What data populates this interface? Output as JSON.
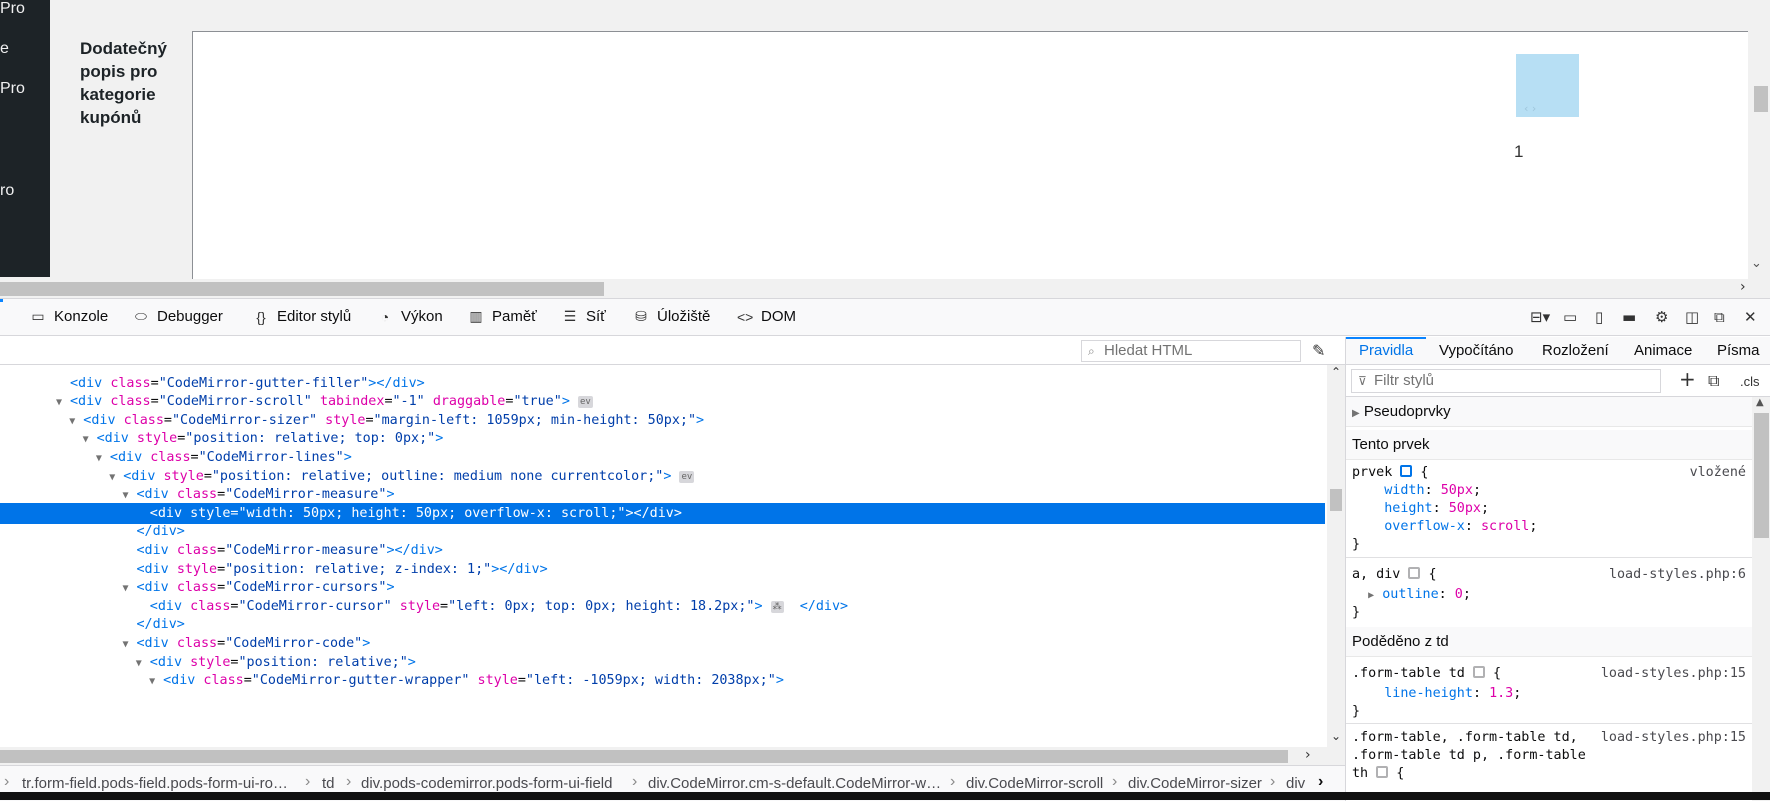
{
  "page": {
    "sidebar_items": [
      "Pro",
      "e",
      "Pro",
      "ro"
    ],
    "field_label": "Dodatečný popis pro kategorie kupónů",
    "editor_line_number": "1",
    "measure_arrows": "‹ ›"
  },
  "toolbar": {
    "tabs": [
      {
        "label": "Konzole",
        "icon": "console-icon"
      },
      {
        "label": "Debugger",
        "icon": "debugger-icon"
      },
      {
        "label": "Editor stylů",
        "icon": "style-editor-icon"
      },
      {
        "label": "Výkon",
        "icon": "performance-icon"
      },
      {
        "label": "Paměť",
        "icon": "memory-icon"
      },
      {
        "label": "Síť",
        "icon": "network-icon"
      },
      {
        "label": "Úložiště",
        "icon": "storage-icon"
      },
      {
        "label": "DOM",
        "icon": "dom-icon"
      }
    ]
  },
  "inspector": {
    "search_placeholder": "Hledat HTML",
    "markup_lines": [
      {
        "cut": true
      },
      {
        "indent": 1,
        "tw": "",
        "html": "<span class='tg'>&lt;div</span> <span class='an'>class</span>=<span class='av'>\"CodeMirror-gutter-filler\"</span><span class='tg'>&gt;&lt;/div&gt;</span>"
      },
      {
        "indent": 1,
        "tw": "▼",
        "html": "<span class='tg'>&lt;div</span> <span class='an'>class</span>=<span class='av'>\"CodeMirror-scroll\"</span> <span class='an'>tabindex</span>=<span class='av'>\"-1\"</span> <span class='an'>draggable</span>=<span class='av'>\"true\"</span><span class='tg'>&gt;</span> <span class='ev'>ev</span>"
      },
      {
        "indent": 2,
        "tw": "▼",
        "html": "<span class='tg'>&lt;div</span> <span class='an'>class</span>=<span class='av'>\"CodeMirror-sizer\"</span> <span class='an'>style</span>=<span class='av'>\"margin-left: 1059px; min-height: 50px;\"</span><span class='tg'>&gt;</span>"
      },
      {
        "indent": 3,
        "tw": "▼",
        "html": "<span class='tg'>&lt;div</span> <span class='an'>style</span>=<span class='av'>\"position: relative; top: 0px;\"</span><span class='tg'>&gt;</span>"
      },
      {
        "indent": 4,
        "tw": "▼",
        "html": "<span class='tg'>&lt;div</span> <span class='an'>class</span>=<span class='av'>\"CodeMirror-lines\"</span><span class='tg'>&gt;</span>"
      },
      {
        "indent": 5,
        "tw": "▼",
        "html": "<span class='tg'>&lt;div</span> <span class='an'>style</span>=<span class='av'>\"position: relative; outline: medium none currentcolor;\"</span><span class='tg'>&gt;</span> <span class='ev'>ev</span>"
      },
      {
        "indent": 6,
        "tw": "▼",
        "html": "<span class='tg'>&lt;div</span> <span class='an'>class</span>=<span class='av'>\"CodeMirror-measure\"</span><span class='tg'>&gt;</span>"
      },
      {
        "indent": 7,
        "tw": "",
        "sel": true,
        "html": "<span class='tg'>&lt;div</span> <span class='an'>style</span>=<span class='av'>\"width: 50px; height: 50px; overflow-x: scroll;\"</span><span class='tg'>&gt;&lt;/div&gt;</span>"
      },
      {
        "indent": 6,
        "tw": "",
        "html": "<span class='tg'>&lt;/div&gt;</span>"
      },
      {
        "indent": 6,
        "tw": "",
        "html": "<span class='tg'>&lt;div</span> <span class='an'>class</span>=<span class='av'>\"CodeMirror-measure\"</span><span class='tg'>&gt;&lt;/div&gt;</span>"
      },
      {
        "indent": 6,
        "tw": "",
        "html": "<span class='tg'>&lt;div</span> <span class='an'>style</span>=<span class='av'>\"position: relative; z-index: 1;\"</span><span class='tg'>&gt;&lt;/div&gt;</span>"
      },
      {
        "indent": 6,
        "tw": "▼",
        "html": "<span class='tg'>&lt;div</span> <span class='an'>class</span>=<span class='av'>\"CodeMirror-cursors\"</span><span class='tg'>&gt;</span>"
      },
      {
        "indent": 7,
        "tw": "",
        "html": "<span class='tg'>&lt;div</span> <span class='an'>class</span>=<span class='av'>\"CodeMirror-cursor\"</span> <span class='an'>style</span>=<span class='av'>\"left: 0px; top: 0px; height: 18.2px;\"</span><span class='tg'>&gt;</span> <span class='ev'>⁂</span>  <span class='tg'>&lt;/div&gt;</span>"
      },
      {
        "indent": 6,
        "tw": "",
        "html": "<span class='tg'>&lt;/div&gt;</span>"
      },
      {
        "indent": 6,
        "tw": "▼",
        "html": "<span class='tg'>&lt;div</span> <span class='an'>class</span>=<span class='av'>\"CodeMirror-code\"</span><span class='tg'>&gt;</span>"
      },
      {
        "indent": 7,
        "tw": "▼",
        "html": "<span class='tg'>&lt;div</span> <span class='an'>style</span>=<span class='av'>\"position: relative;\"</span><span class='tg'>&gt;</span>"
      },
      {
        "indent": 8,
        "tw": "▼",
        "html": "<span class='tg'>&lt;div</span> <span class='an'>class</span>=<span class='av'>\"CodeMirror-gutter-wrapper\"</span> <span class='an'>style</span>=<span class='av'>\"left: -1059px; width: 2038px;\"</span><span class='tg'>&gt;</span>"
      },
      {
        "cut": true
      }
    ],
    "breadcrumbs": [
      "tr.form-field.pods-field.pods-form-ui-ro…",
      "td",
      "div.pods-codemirror.pods-form-ui-field",
      "div.CodeMirror.cm-s-default.CodeMirror-w…",
      "div.CodeMirror-scroll",
      "div.CodeMirror-sizer",
      "div"
    ]
  },
  "rules": {
    "tabs": [
      "Pravidla",
      "Vypočítáno",
      "Rozložení",
      "Animace",
      "Písma"
    ],
    "filter_placeholder": "Filtr stylů",
    "cls_label": ".cls",
    "pseudo_label": "Pseudoprvky",
    "this_element_label": "Tento prvek",
    "element_selector": "prvek",
    "inline_label": "vložené",
    "element_decls": [
      [
        "width",
        "50px"
      ],
      [
        "height",
        "50px"
      ],
      [
        "overflow-x",
        "scroll"
      ]
    ],
    "rule2_selector": "a, div",
    "rule2_source": "load-styles.php:6",
    "rule2_decls": [
      [
        "outline",
        "0"
      ]
    ],
    "inherited_label": "Poděděno z td",
    "rule3_selector": ".form-table td",
    "rule3_source": "load-styles.php:15",
    "rule3_decls": [
      [
        "line-height",
        "1.3"
      ]
    ],
    "rule4_selector_lines": [
      ".form-table, .form-table td,",
      ".form-table td p, .form-table",
      "th"
    ],
    "rule4_source": "load-styles.php:15"
  },
  "colors": {
    "accent": "#0074e8",
    "selection": "#0074e8",
    "attr_name": "#dd00a9",
    "attr_value": "#003eaa",
    "sidebar": "#1d2327"
  }
}
